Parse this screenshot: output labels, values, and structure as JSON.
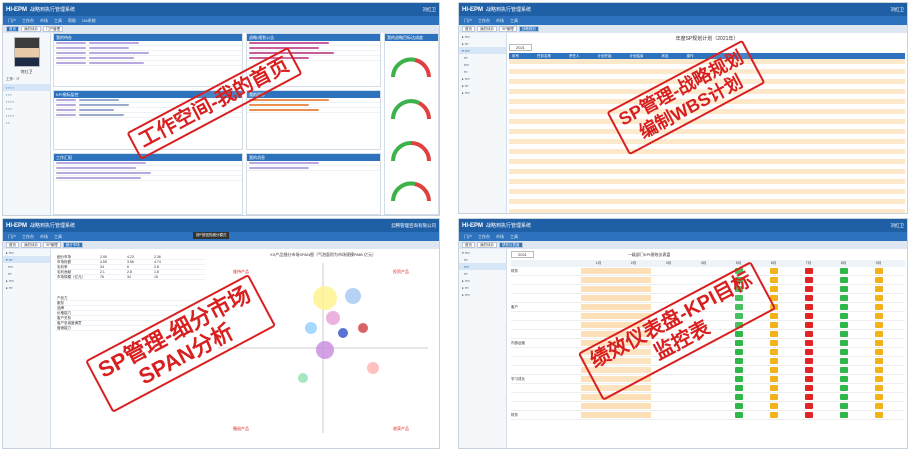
{
  "app": {
    "logo": "HI-EPM",
    "title": "战略到执行管理系统",
    "company": "云腾管理咨询有限公司",
    "user": "刘红卫"
  },
  "nav": [
    "门户",
    "工作台",
    "市场",
    "工具",
    "帮助",
    "OA系统"
  ],
  "panel1": {
    "tabs": [
      "首页",
      "我的待办",
      "门户管理"
    ],
    "profile": {
      "name": "何红卫",
      "role_label": "工作：",
      "role_value": "IT"
    },
    "boxes": {
      "todo": "我的待办",
      "notice": "战略/规划公告",
      "gauge": "我的战略目标达成度",
      "kpi": "KPI指标监控",
      "msg": "我的消息",
      "report": "工作汇报"
    },
    "watermark": "工作空间-我的首页"
  },
  "panel2": {
    "tabs": [
      "首页",
      "我的待办",
      "SP管理",
      "战略规划"
    ],
    "heading": "年度SP规划计划（2021年）",
    "year": "2021",
    "cols": [
      "序号",
      "任务名称",
      "责任人",
      "计划开始",
      "计划结束",
      "状态",
      "操作"
    ],
    "watermark": [
      "SP管理-战略规划",
      "编制WBS计划"
    ]
  },
  "panel3": {
    "tabs": [
      "首页",
      "我的待办",
      "SP管理",
      "细分市场"
    ],
    "toolbar": "按P按钮的细分模式",
    "chart_title": "XX产品细分市场SPAN图（气泡面积为市场规模RMB 亿元）",
    "quadrants": {
      "tl": "维持产品",
      "tr": "投资产品",
      "bl": "撤退产品",
      "br": "收获产品"
    },
    "table_head": [
      "细分市场",
      "细分市场",
      "细分市场",
      "细分市场"
    ],
    "table_rows": [
      [
        "细分市场",
        2.95,
        4.23,
        2.36
      ],
      [
        "市场份额",
        4.59,
        3.56,
        4.74
      ],
      [
        "毛利率",
        34,
        6,
        0.8
      ],
      [
        "毛利贡献",
        2.1,
        2.8,
        1.8
      ],
      [
        "市场规模（亿元）",
        76,
        34,
        19
      ]
    ],
    "factors": [
      "产品力",
      "服务",
      "品牌",
      "价格能力",
      "客户关系",
      "客户忠诚度满意",
      "营销能力"
    ],
    "watermark": [
      "SP管理-细分市场",
      "SPAN分析"
    ]
  },
  "panel4": {
    "tabs": [
      "首页",
      "我的待办",
      "绩效仪表盘"
    ],
    "heading": "一级部门KPI绩效仪表盘",
    "year": "2021",
    "groups": [
      "财务",
      "客户",
      "内部运营",
      "学习成长"
    ],
    "months": [
      "1月",
      "2月",
      "3月",
      "4月",
      "5月",
      "6月",
      "7月",
      "8月",
      "9月"
    ],
    "status_colors": [
      "#e02525",
      "#2fb84a",
      "#f2b31a"
    ],
    "watermark": [
      "绩效仪表盘-KPI目标",
      "监控表"
    ]
  },
  "colors": {
    "brand": "#1f5fa6",
    "accent": "#2c72bd",
    "warn": "#d92020"
  }
}
